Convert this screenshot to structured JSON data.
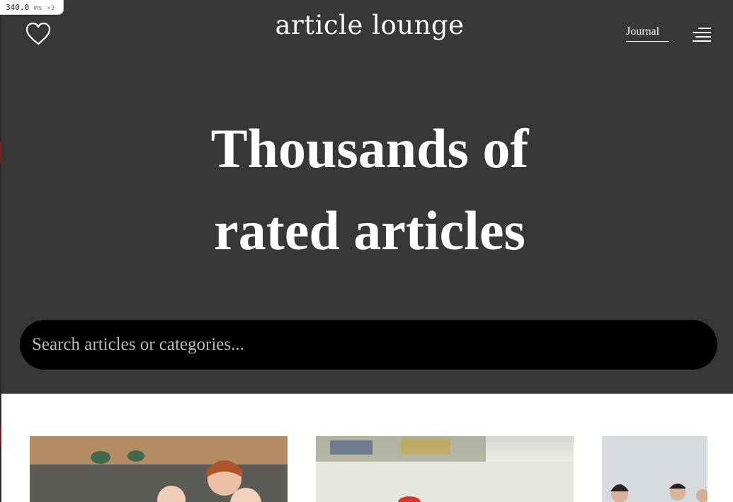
{
  "perf_badge": {
    "time": "340.0",
    "unit": "ms",
    "multiplier": "×2"
  },
  "header": {
    "logo": "article lounge",
    "journal_link": "Journal"
  },
  "hero": {
    "headline_line1": "Thousands of",
    "headline_line2": "rated articles"
  },
  "search": {
    "placeholder": "Search articles or categories...",
    "value": ""
  },
  "icons": {
    "favorites": "heart-icon",
    "menu": "hamburger-menu-icon"
  },
  "colors": {
    "hero_background": "#373737",
    "search_background": "#000000",
    "text": "#ffffff",
    "page_background": "#ffffff"
  }
}
